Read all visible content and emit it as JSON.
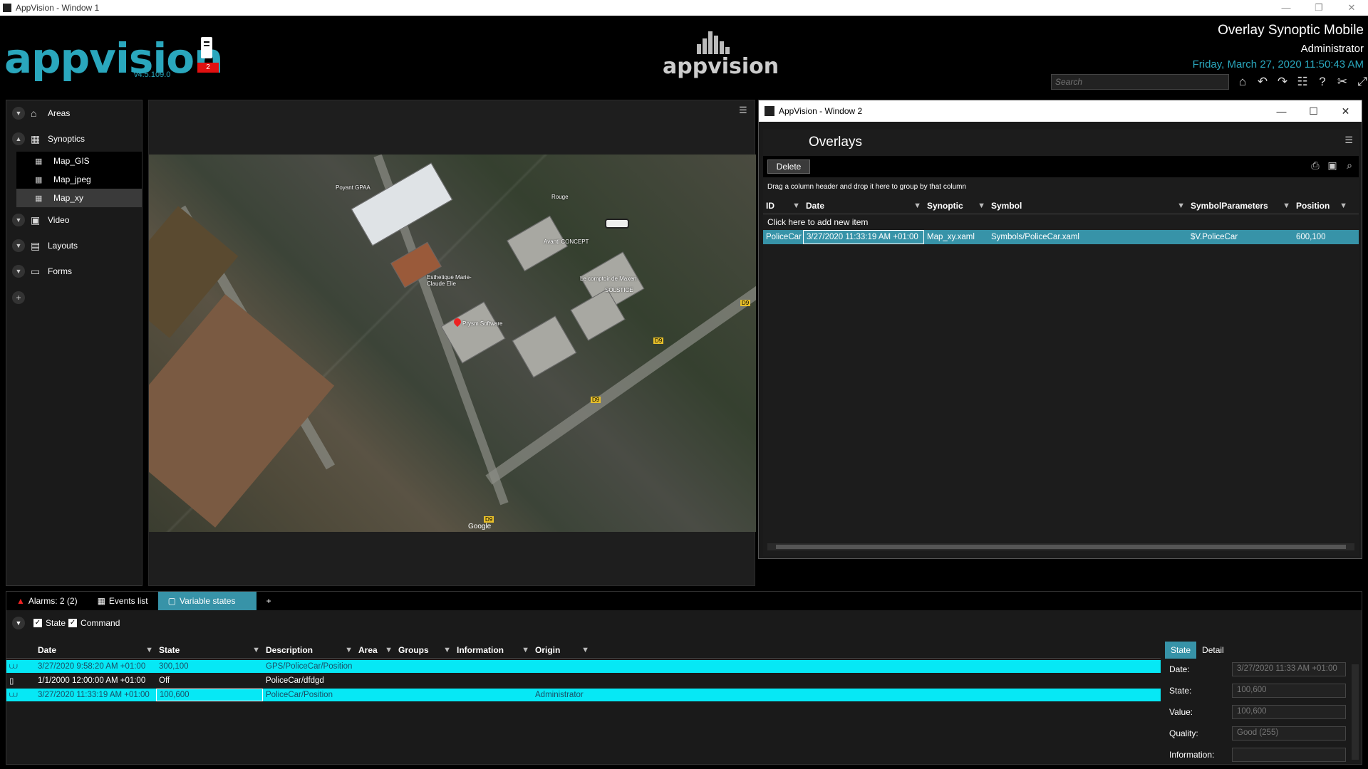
{
  "os_window": {
    "title": "AppVision - Window 1"
  },
  "header": {
    "logo": "appvision",
    "version": "v4.5.109.0",
    "server_badge": "2",
    "center_logo": "appvision",
    "title": "Overlay Synoptic Mobile",
    "user": "Administrator",
    "datetime": "Friday, March 27, 2020 11:50:43 AM",
    "search_placeholder": "Search",
    "accent_color": "#2aa7bd"
  },
  "sidebar": {
    "items": [
      {
        "label": "Areas",
        "icon": "home-icon"
      },
      {
        "label": "Synoptics",
        "icon": "map-icon"
      },
      {
        "label": "Video",
        "icon": "video-icon"
      },
      {
        "label": "Layouts",
        "icon": "layout-icon"
      },
      {
        "label": "Forms",
        "icon": "form-icon"
      }
    ],
    "synoptics_children": [
      {
        "label": "Map_GIS"
      },
      {
        "label": "Map_jpeg"
      },
      {
        "label": "Map_xy",
        "selected": true
      }
    ]
  },
  "map": {
    "labels": [
      "Poyant GPAA",
      "Avanti CONCEPT",
      "Esthetique Marie-Claude Elie",
      "Le comptoir de Maxen",
      "Rouge",
      "Prysm Software",
      "SOLSTICE"
    ],
    "road_markers": [
      "D9",
      "D9",
      "D9",
      "D9"
    ],
    "attribution": "Google"
  },
  "window2": {
    "title": "AppVision - Window 2",
    "pane_title": "Overlays",
    "delete_label": "Delete",
    "group_hint": "Drag a column header and drop it here to group by that column",
    "columns": [
      "ID",
      "Date",
      "Synoptic",
      "Symbol",
      "SymbolParameters",
      "Position"
    ],
    "add_row_label": "Click here to add new item",
    "rows": [
      {
        "id": "PoliceCar",
        "date": "3/27/2020 11:33:19 AM +01:00",
        "synoptic": "Map_xy.xaml",
        "symbol": "Symbols/PoliceCar.xaml",
        "params": "$V.PoliceCar",
        "position": "600,100"
      }
    ]
  },
  "bottom": {
    "tabs": [
      {
        "label": "Alarms: 2 (2)"
      },
      {
        "label": "Events list"
      },
      {
        "label": "Variable states",
        "active": true
      },
      {
        "label": "+"
      }
    ],
    "filters": {
      "state": "State",
      "command": "Command"
    },
    "columns": [
      "Date",
      "State",
      "Description",
      "Area",
      "Groups",
      "Information",
      "Origin"
    ],
    "rows": [
      {
        "date": "3/27/2020 9:58:20 AM +01:00",
        "state": "300,100",
        "description": "GPS/PoliceCar/Position",
        "area": "",
        "groups": "",
        "information": "",
        "origin": "",
        "highlight": true
      },
      {
        "date": "1/1/2000 12:00:00 AM +01:00",
        "state": "Off",
        "description": "PoliceCar/dfdgd",
        "area": "",
        "groups": "",
        "information": "",
        "origin": "",
        "highlight": false
      },
      {
        "date": "3/27/2020 11:33:19 AM +01:00",
        "state": "100,600",
        "description": "PoliceCar/Position",
        "area": "",
        "groups": "",
        "information": "",
        "origin": "Administrator",
        "highlight": true
      }
    ],
    "detail": {
      "tabs": [
        "State",
        "Detail"
      ],
      "fields": [
        {
          "label": "Date:",
          "value": "3/27/2020 11:33 AM +01:00"
        },
        {
          "label": "State:",
          "value": "100,600"
        },
        {
          "label": "Value:",
          "value": "100,600"
        },
        {
          "label": "Quality:",
          "value": "Good (255)"
        },
        {
          "label": "Information:",
          "value": ""
        }
      ]
    }
  }
}
